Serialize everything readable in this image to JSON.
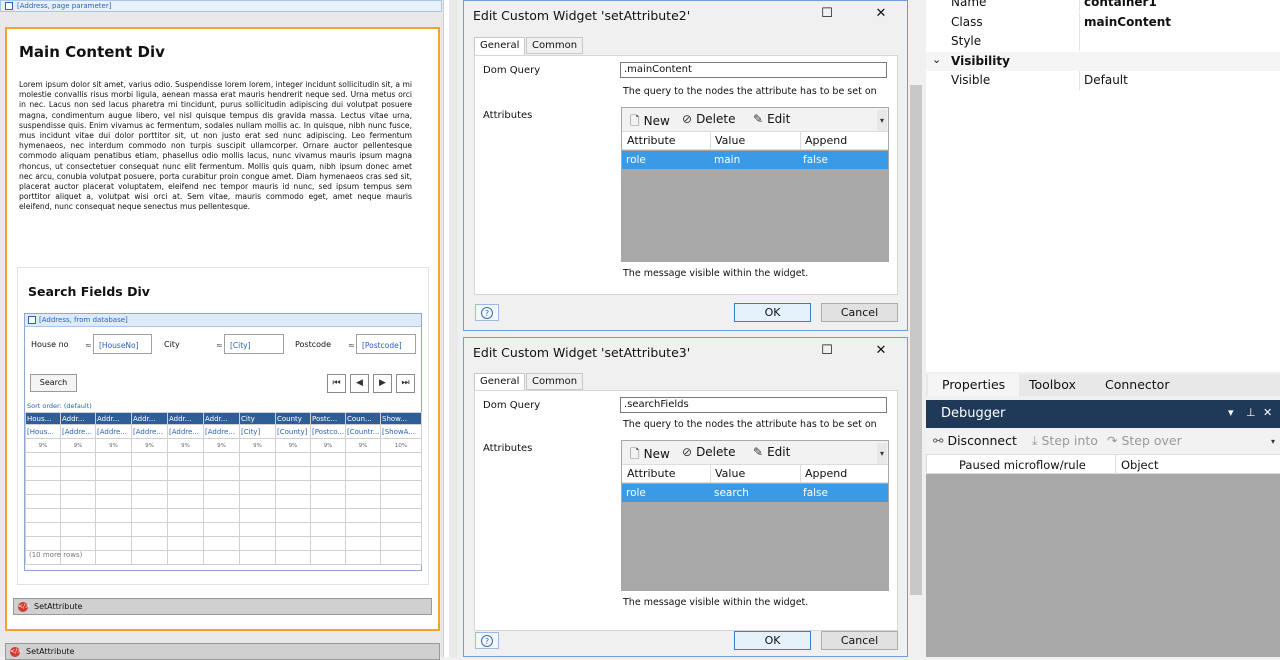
{
  "left": {
    "topbar": "[Address, page parameter]",
    "main_title": "Main Content Div",
    "lorem": "Lorem ipsum dolor sit amet, varius odio. Suspendisse lorem lorem, integer incidunt sollicitudin sit, a mi molestie convallis risus morbi ligula, aenean massa erat mauris hendrerit neque sed. Urna metus orci in nec. Lacus non sed lacus pharetra mi tincidunt, purus sollicitudin adipiscing dui volutpat posuere magna, condimentum augue libero, vel nisl quisque tempus dis gravida massa. Lectus vitae urna, suspendisse quis. Enim vivamus ac fermentum, sodales nullam mollis ac. In quisque, nibh nunc fusce, mus incidunt vitae dui dolor porttitor sit, ut non justo erat sed nunc adipiscing. Leo fermentum hymenaeos, nec interdum commodo non turpis suscipit ullamcorper. Ornare auctor pellentesque commodo aliquam penatibus etiam, phasellus odio mollis lacus, nunc vivamus mauris ipsum magna rhoncus, ut consectetuer consequat nunc elit fermentum. Mollis quis quam, nibh ipsum donec amet nec arcu, conubia volutpat posuere, porta curabitur proin congue amet. Diam hymenaeos cras sed sit, placerat auctor placerat voluptatem, eleifend nec tempor mauris id nunc, sed ipsum tempus sem porttitor aliquet a, volutpat wisi orci at. Sem vitae, mauris commodo eget, amet neque mauris eleifend, nunc consequat neque senectus mus pellentesque.",
    "search_title": "Search Fields Div",
    "dv_header": "[Address, from database]",
    "fields": [
      {
        "label": "House no",
        "approx": "≈",
        "value": "[HouseNo]"
      },
      {
        "label": "City",
        "approx": "≈",
        "value": "[City]"
      },
      {
        "label": "Postcode",
        "approx": "≈",
        "value": "[Postcode]"
      }
    ],
    "search_button": "Search",
    "nav": [
      "⏮",
      "◀",
      "▶",
      "⏭"
    ],
    "sort_order": "Sort order: (default)",
    "grid_headers": [
      "Hous...",
      "Addr...",
      "Addr...",
      "Addr...",
      "Addr...",
      "Addr...",
      "City",
      "County",
      "Postc...",
      "Coun...",
      "Show..."
    ],
    "grid_binds": [
      "[Hous...",
      "[Addre...",
      "[Addre...",
      "[Addre...",
      "[Addre...",
      "[Addre...",
      "[City]",
      "[County]",
      "[Postco...",
      "[Countr...",
      "[ShowA..."
    ],
    "grid_pcts": [
      "9%",
      "9%",
      "9%",
      "9%",
      "9%",
      "9%",
      "9%",
      "9%",
      "9%",
      "9%",
      "10%"
    ],
    "more_rows": "(10 more rows)",
    "set_attribute_1": "SetAttribute",
    "set_attribute_2": "SetAttribute"
  },
  "dialog1": {
    "title": "Edit Custom Widget 'setAttribute2'",
    "tab_general": "General",
    "tab_common": "Common",
    "dom_query_label": "Dom Query",
    "dom_query_value": ".mainContent",
    "dom_query_hint": "The query to the nodes the attribute has to be set on",
    "attributes_label": "Attributes",
    "toolbar": {
      "new": "New",
      "delete": "Delete",
      "edit": "Edit"
    },
    "columns": [
      "Attribute",
      "Value",
      "Append"
    ],
    "row": {
      "attribute": "role",
      "value": "main",
      "append": "false"
    },
    "message": "The message visible within the widget.",
    "ok": "OK",
    "cancel": "Cancel"
  },
  "dialog2": {
    "title": "Edit Custom Widget 'setAttribute3'",
    "tab_general": "General",
    "tab_common": "Common",
    "dom_query_label": "Dom Query",
    "dom_query_value": ".searchFields",
    "dom_query_hint": "The query to the nodes the attribute has to be set on",
    "attributes_label": "Attributes",
    "toolbar": {
      "new": "New",
      "delete": "Delete",
      "edit": "Edit"
    },
    "columns": [
      "Attribute",
      "Value",
      "Append"
    ],
    "row": {
      "attribute": "role",
      "value": "search",
      "append": "false"
    },
    "message": "The message visible within the widget.",
    "ok": "OK",
    "cancel": "Cancel"
  },
  "properties": {
    "name_key": "Name",
    "name_value": "container1",
    "class_key": "Class",
    "class_value": "mainContent",
    "style_key": "Style",
    "visibility_group": "Visibility",
    "visible_key": "Visible",
    "visible_value": "Default"
  },
  "panel_tabs": [
    "Properties",
    "Toolbox",
    "Connector"
  ],
  "debugger": {
    "title": "Debugger",
    "disconnect": "Disconnect",
    "step_into": "Step into",
    "step_over": "Step over",
    "col_paused": "Paused microflow/rule",
    "col_object": "Object"
  },
  "colors": {
    "accent_orange": "#f0a42a",
    "selection_blue": "#3b9ae6",
    "grid_header_blue": "#2f5e96",
    "debugger_title": "#1e3a58"
  }
}
